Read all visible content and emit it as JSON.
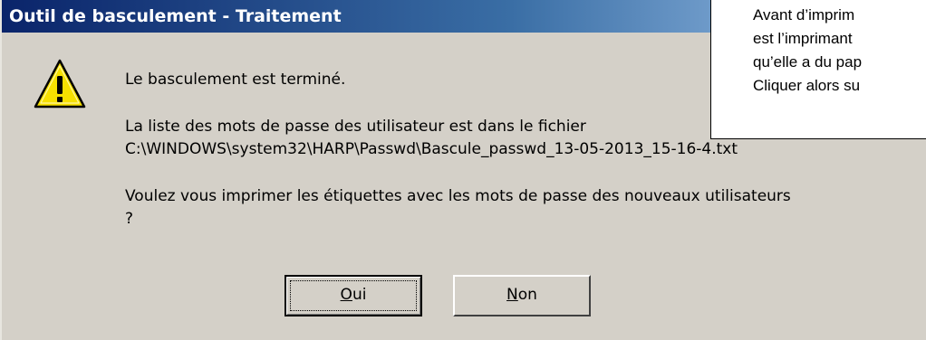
{
  "window": {
    "title": "Outil de basculement - Traitement"
  },
  "dialog": {
    "icon": "warning-icon",
    "message_line1": "Le basculement est terminé.",
    "message_line2": "La liste des mots de passe des utilisateur est dans le fichier",
    "message_line3": "C:\\WINDOWS\\system32\\HARP\\Passwd\\Bascule_passwd_13-05-2013_15-16-4.txt",
    "message_line4": "Voulez vous imprimer les étiquettes avec les mots de passe des nouveaux utilisateurs",
    "message_line5": "?"
  },
  "buttons": {
    "yes": {
      "mnemonic": "O",
      "rest": "ui"
    },
    "no": {
      "mnemonic": "N",
      "rest": "on"
    }
  },
  "overlay_note": {
    "line1": "Avant  d’imprim",
    "line2": "est  l’imprimant",
    "line3": "qu’elle a du pap",
    "line4": "Cliquer alors su"
  },
  "colors": {
    "dialog_bg": "#d4d0c8",
    "title_gradient_start": "#0a246a",
    "title_gradient_end": "#a6caf0",
    "warning_yellow": "#f6e000"
  }
}
